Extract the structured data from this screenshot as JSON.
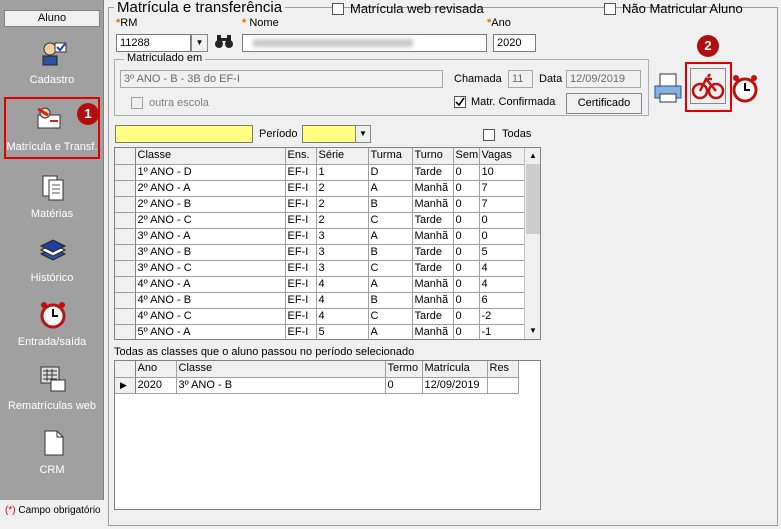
{
  "sidebar": {
    "title": "Aluno",
    "items": [
      {
        "label": "Cadastro"
      },
      {
        "label": "Matrícula e Transf."
      },
      {
        "label": "Matérias"
      },
      {
        "label": "Histórico"
      },
      {
        "label": "Entrada/saída"
      },
      {
        "label": "Rematrículas web"
      },
      {
        "label": "CRM"
      }
    ],
    "footer_star": "(*)",
    "footer_text": " Campo obrigatório"
  },
  "badges": {
    "one": "1",
    "two": "2"
  },
  "header": {
    "title": "Matrícula e transferência",
    "web_check_label": "Matrícula web revisada",
    "no_enroll_label": "Não Matricular Aluno"
  },
  "form": {
    "star": "*",
    "rm_label": "RM",
    "rm_value": "11288",
    "name_label": "Nome",
    "name_value": "",
    "ano_label": "Ano",
    "ano_value": "2020",
    "group_title": "Matriculado em",
    "class_value": "3º ANO - B - 3B do EF-I",
    "chamada_label": "Chamada",
    "chamada_value": "11",
    "data_label": "Data",
    "data_value": "12/09/2019",
    "outra_escola_label": "outra escola",
    "matr_confirmada_label": "Matr. Confirmada",
    "certificado_label": "Certificado"
  },
  "filters": {
    "periodo_label": "Período",
    "todas_label": "Todas"
  },
  "classes_table": {
    "headers": [
      "Classe",
      "Ens.",
      "Série",
      "Turma",
      "Turno",
      "Sem",
      "Vagas"
    ],
    "rows": [
      [
        "1º ANO - D",
        "EF-I",
        "1",
        "D",
        "Tarde",
        "0",
        "10"
      ],
      [
        "2º ANO - A",
        "EF-I",
        "2",
        "A",
        "Manhã",
        "0",
        "7"
      ],
      [
        "2º ANO - B",
        "EF-I",
        "2",
        "B",
        "Manhã",
        "0",
        "7"
      ],
      [
        "2º ANO - C",
        "EF-I",
        "2",
        "C",
        "Tarde",
        "0",
        "0"
      ],
      [
        "3º ANO - A",
        "EF-I",
        "3",
        "A",
        "Manhã",
        "0",
        "0"
      ],
      [
        "3º ANO - B",
        "EF-I",
        "3",
        "B",
        "Tarde",
        "0",
        "5"
      ],
      [
        "3º ANO - C",
        "EF-I",
        "3",
        "C",
        "Tarde",
        "0",
        "4"
      ],
      [
        "4º ANO - A",
        "EF-I",
        "4",
        "A",
        "Manhã",
        "0",
        "4"
      ],
      [
        "4º ANO - B",
        "EF-I",
        "4",
        "B",
        "Manhã",
        "0",
        "6"
      ],
      [
        "4º ANO - C",
        "EF-I",
        "4",
        "C",
        "Tarde",
        "0",
        "-2"
      ],
      [
        "5º ANO - A",
        "EF-I",
        "5",
        "A",
        "Manhã",
        "0",
        "-1"
      ]
    ]
  },
  "history": {
    "caption": "Todas as classes que o aluno passou no período selecionado",
    "headers": [
      "Ano",
      "Classe",
      "Termo",
      "Matrícula",
      "Res"
    ],
    "rows": [
      [
        "2020",
        "3º ANO - B",
        "0",
        "12/09/2019",
        ""
      ]
    ]
  },
  "colors": {
    "accent_red": "#e00000",
    "badge": "#b01010",
    "yellow": "#ffff80"
  }
}
